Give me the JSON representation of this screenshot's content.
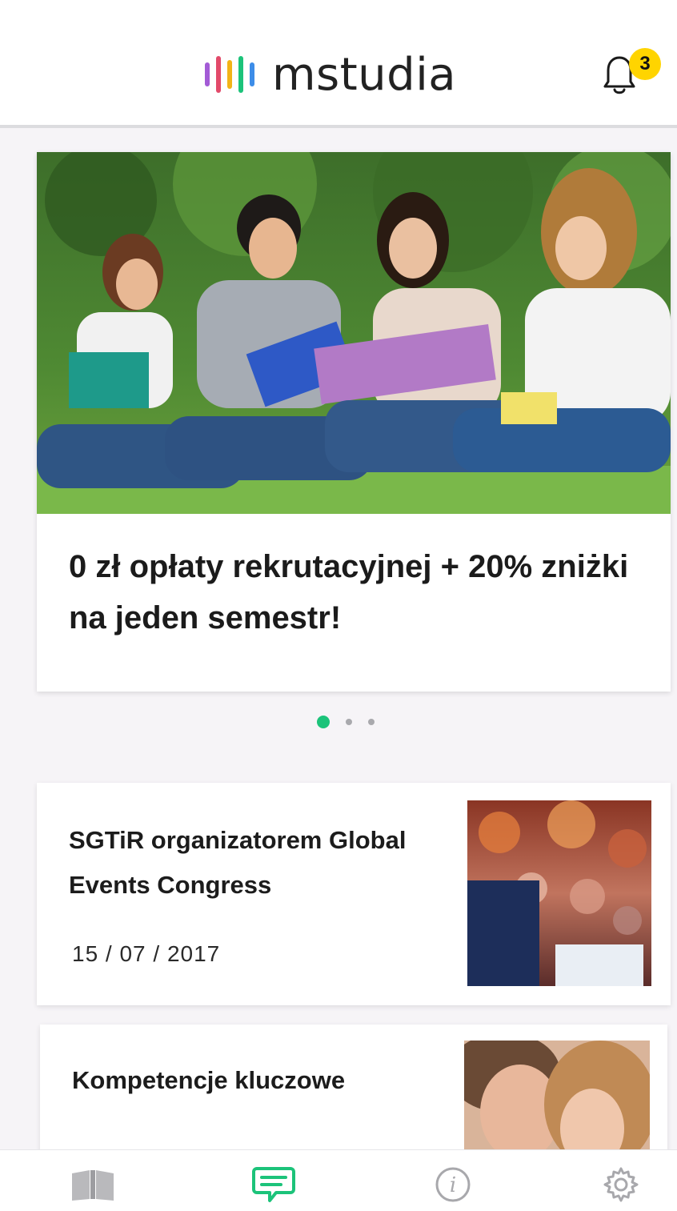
{
  "app": {
    "logo_text": "mstudia",
    "logo_bar_colors": [
      "#a35bd6",
      "#e24a6a",
      "#f2b417",
      "#1cc37a",
      "#3d8de8"
    ],
    "notification_count": "3",
    "accent_color": "#1cc37a",
    "badge_color": "#ffd400"
  },
  "promo": {
    "title": "0 zł opłaty rekrutacyjnej + 20% zniżki na jeden semestr!",
    "image": "students-sitting-on-grass-photo",
    "carousel_pages": 3,
    "carousel_active_index": 0
  },
  "news": [
    {
      "title": "SGTiR organizatorem Global Events Congress",
      "date": "15 / 07 / 2017",
      "image": "conference-audience-photo"
    },
    {
      "title": "Kompetencje kluczowe",
      "date": "",
      "image": "young-couple-photo"
    }
  ],
  "bottom_nav": [
    {
      "name": "book-icon",
      "active": false
    },
    {
      "name": "chat-icon",
      "active": true
    },
    {
      "name": "info-icon",
      "active": false
    },
    {
      "name": "gear-icon",
      "active": false
    }
  ]
}
